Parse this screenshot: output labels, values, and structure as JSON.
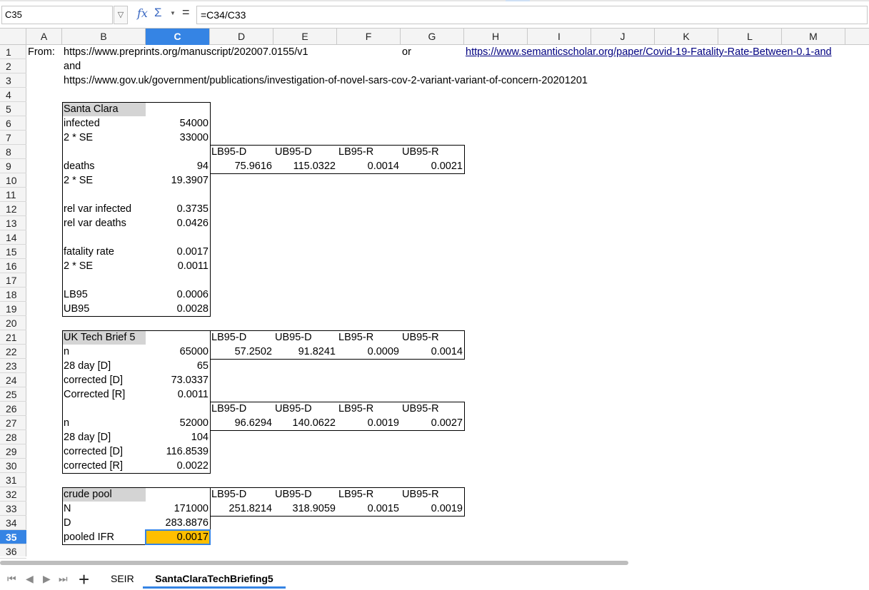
{
  "formula_bar": {
    "cell_ref": "C35",
    "dropdown_glyph": "▽",
    "fx_glyph": "fx",
    "sum_glyph": "Σ",
    "sum_dropdown_glyph": "▼",
    "equals_glyph": "=",
    "formula": "=C34/C33"
  },
  "columns": [
    "A",
    "B",
    "C",
    "D",
    "E",
    "F",
    "G",
    "H",
    "I",
    "J",
    "K",
    "L",
    "M"
  ],
  "selected_column": "C",
  "rows": [
    "1",
    "2",
    "3",
    "4",
    "5",
    "6",
    "7",
    "8",
    "9",
    "10",
    "11",
    "12",
    "13",
    "14",
    "15",
    "16",
    "17",
    "18",
    "19",
    "20",
    "21",
    "22",
    "23",
    "24",
    "25",
    "26",
    "27",
    "28",
    "29",
    "30",
    "31",
    "32",
    "33",
    "34",
    "35",
    "36"
  ],
  "selected_row": "35",
  "cells": {
    "A1": "From:",
    "B1": "https://www.preprints.org/manuscript/202007.0155/v1",
    "G1": "or",
    "H1": "https://www.semanticscholar.org/paper/Covid-19-Fatality-Rate-Between-0.1-and",
    "B2": "and",
    "B3": "https://www.gov.uk/government/publications/investigation-of-novel-sars-cov-2-variant-variant-of-concern-20201201",
    "B5": "Santa Clara",
    "B6": "infected",
    "C6": "54000",
    "B7": "2 * SE",
    "C7": "33000",
    "D8": "LB95-D",
    "E8": "UB95-D",
    "F8": "LB95-R",
    "G8": "UB95-R",
    "B9": "deaths",
    "C9": "94",
    "D9": "75.9616",
    "E9": "115.0322",
    "F9": "0.0014",
    "G9": "0.0021",
    "B10": "2 * SE",
    "C10": "19.3907",
    "B12": "rel var infected",
    "C12": "0.3735",
    "B13": "rel var deaths",
    "C13": "0.0426",
    "B15": "fatality rate",
    "C15": "0.0017",
    "B16": "2 * SE",
    "C16": "0.0011",
    "B18": "LB95",
    "C18": "0.0006",
    "B19": "UB95",
    "C19": "0.0028",
    "B21": "UK Tech Brief 5",
    "D21": "LB95-D",
    "E21": "UB95-D",
    "F21": "LB95-R",
    "G21": "UB95-R",
    "B22": "n",
    "C22": "65000",
    "D22": "57.2502",
    "E22": "91.8241",
    "F22": "0.0009",
    "G22": "0.0014",
    "B23": "28 day [D]",
    "C23": "65",
    "B24": "corrected [D]",
    "C24": "73.0337",
    "B25": "Corrected [R]",
    "C25": "0.0011",
    "D26": "LB95-D",
    "E26": "UB95-D",
    "F26": "LB95-R",
    "G26": "UB95-R",
    "B27": "n",
    "C27": "52000",
    "D27": "96.6294",
    "E27": "140.0622",
    "F27": "0.0019",
    "G27": "0.0027",
    "B28": "28 day [D]",
    "C28": "104",
    "B29": "corrected [D]",
    "C29": "116.8539",
    "B30": "corrected [R]",
    "C30": "0.0022",
    "B32": "crude pool",
    "D32": "LB95-D",
    "E32": "UB95-D",
    "F32": "LB95-R",
    "G32": "UB95-R",
    "B33": "N",
    "C33": "171000",
    "D33": "251.8214",
    "E33": "318.9059",
    "F33": "0.0015",
    "G33": "0.0019",
    "B34": "D",
    "C34": "283.8876",
    "B35": "pooled IFR",
    "C35": "0.0017"
  },
  "sheet_tabs": {
    "nav_first": "⏮",
    "nav_prev": "◀",
    "nav_next": "▶",
    "nav_last": "⏭",
    "add": "+",
    "tabs": [
      "SEIR",
      "SantaClaraTechBriefing5"
    ],
    "active": "SantaClaraTechBriefing5"
  },
  "colors": {
    "selection": "#3584e4",
    "highlight_cell": "#ffbf00",
    "section_header": "#d4d4d4",
    "link": "#000080"
  }
}
